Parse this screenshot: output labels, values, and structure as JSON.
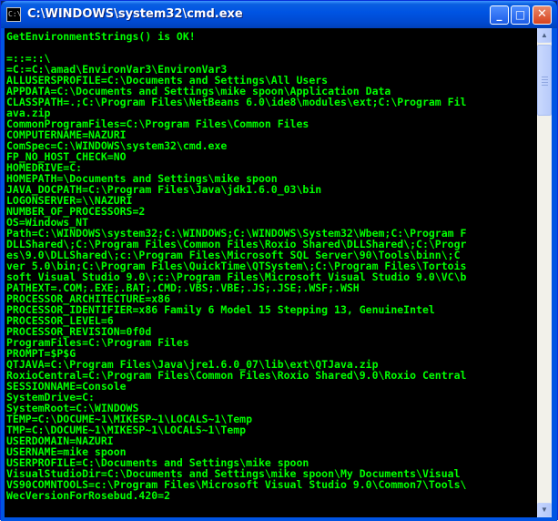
{
  "window": {
    "title": "C:\\WINDOWS\\system32\\cmd.exe",
    "icon": "cmd-icon",
    "icon_glyph": "C:\\",
    "buttons": {
      "minimize": "_",
      "maximize": "□",
      "close": "✕"
    }
  },
  "console": {
    "text_color": "#00ff00",
    "background": "#000000",
    "lines": [
      "GetEnvironmentStrings() is OK!",
      "",
      "=::=::\\",
      "=C:=C:\\amad\\EnvironVar3\\EnvironVar3",
      "ALLUSERSPROFILE=C:\\Documents and Settings\\All Users",
      "APPDATA=C:\\Documents and Settings\\mike spoon\\Application Data",
      "CLASSPATH=.;C:\\Program Files\\NetBeans 6.0\\ide8\\modules\\ext;C:\\Program Fil",
      "ava.zip",
      "CommonProgramFiles=C:\\Program Files\\Common Files",
      "COMPUTERNAME=NAZURI",
      "ComSpec=C:\\WINDOWS\\system32\\cmd.exe",
      "FP_NO_HOST_CHECK=NO",
      "HOMEDRIVE=C:",
      "HOMEPATH=\\Documents and Settings\\mike spoon",
      "JAVA_DOCPATH=C:\\Program Files\\Java\\jdk1.6.0_03\\bin",
      "LOGONSERVER=\\\\NAZURI",
      "NUMBER_OF_PROCESSORS=2",
      "OS=Windows_NT",
      "Path=C:\\WINDOWS\\system32;C:\\WINDOWS;C:\\WINDOWS\\System32\\Wbem;C:\\Program F",
      "DLLShared\\;C:\\Program Files\\Common Files\\Roxio Shared\\DLLShared\\;C:\\Progr",
      "es\\9.0\\DLLShared\\;c:\\Program Files\\Microsoft SQL Server\\90\\Tools\\binn\\;C",
      "ver 5.0\\bin;C:\\Program Files\\QuickTime\\QTSystem\\;C:\\Program Files\\Tortois",
      "soft Visual Studio 9.0\\;c:\\Program Files\\Microsoft Visual Studio 9.0\\VC\\b",
      "PATHEXT=.COM;.EXE;.BAT;.CMD;.VBS;.VBE;.JS;.JSE;.WSF;.WSH",
      "PROCESSOR_ARCHITECTURE=x86",
      "PROCESSOR_IDENTIFIER=x86 Family 6 Model 15 Stepping 13, GenuineIntel",
      "PROCESSOR_LEVEL=6",
      "PROCESSOR_REVISION=0f0d",
      "ProgramFiles=C:\\Program Files",
      "PROMPT=$P$G",
      "QTJAVA=C:\\Program Files\\Java\\jre1.6.0_07\\lib\\ext\\QTJava.zip",
      "RoxioCentral=C:\\Program Files\\Common Files\\Roxio Shared\\9.0\\Roxio Central",
      "SESSIONNAME=Console",
      "SystemDrive=C:",
      "SystemRoot=C:\\WINDOWS",
      "TEMP=C:\\DOCUME~1\\MIKESP~1\\LOCALS~1\\Temp",
      "TMP=C:\\DOCUME~1\\MIKESP~1\\LOCALS~1\\Temp",
      "USERDOMAIN=NAZURI",
      "USERNAME=mike spoon",
      "USERPROFILE=C:\\Documents and Settings\\mike spoon",
      "VisualStudioDir=C:\\Documents and Settings\\mike spoon\\My Documents\\Visual",
      "VS90COMNTOOLS=c:\\Program Files\\Microsoft Visual Studio 9.0\\Common7\\Tools\\",
      "WecVersionForRosebud.420=2"
    ]
  },
  "scrollbar": {
    "up_glyph": "▲",
    "down_glyph": "▼"
  }
}
